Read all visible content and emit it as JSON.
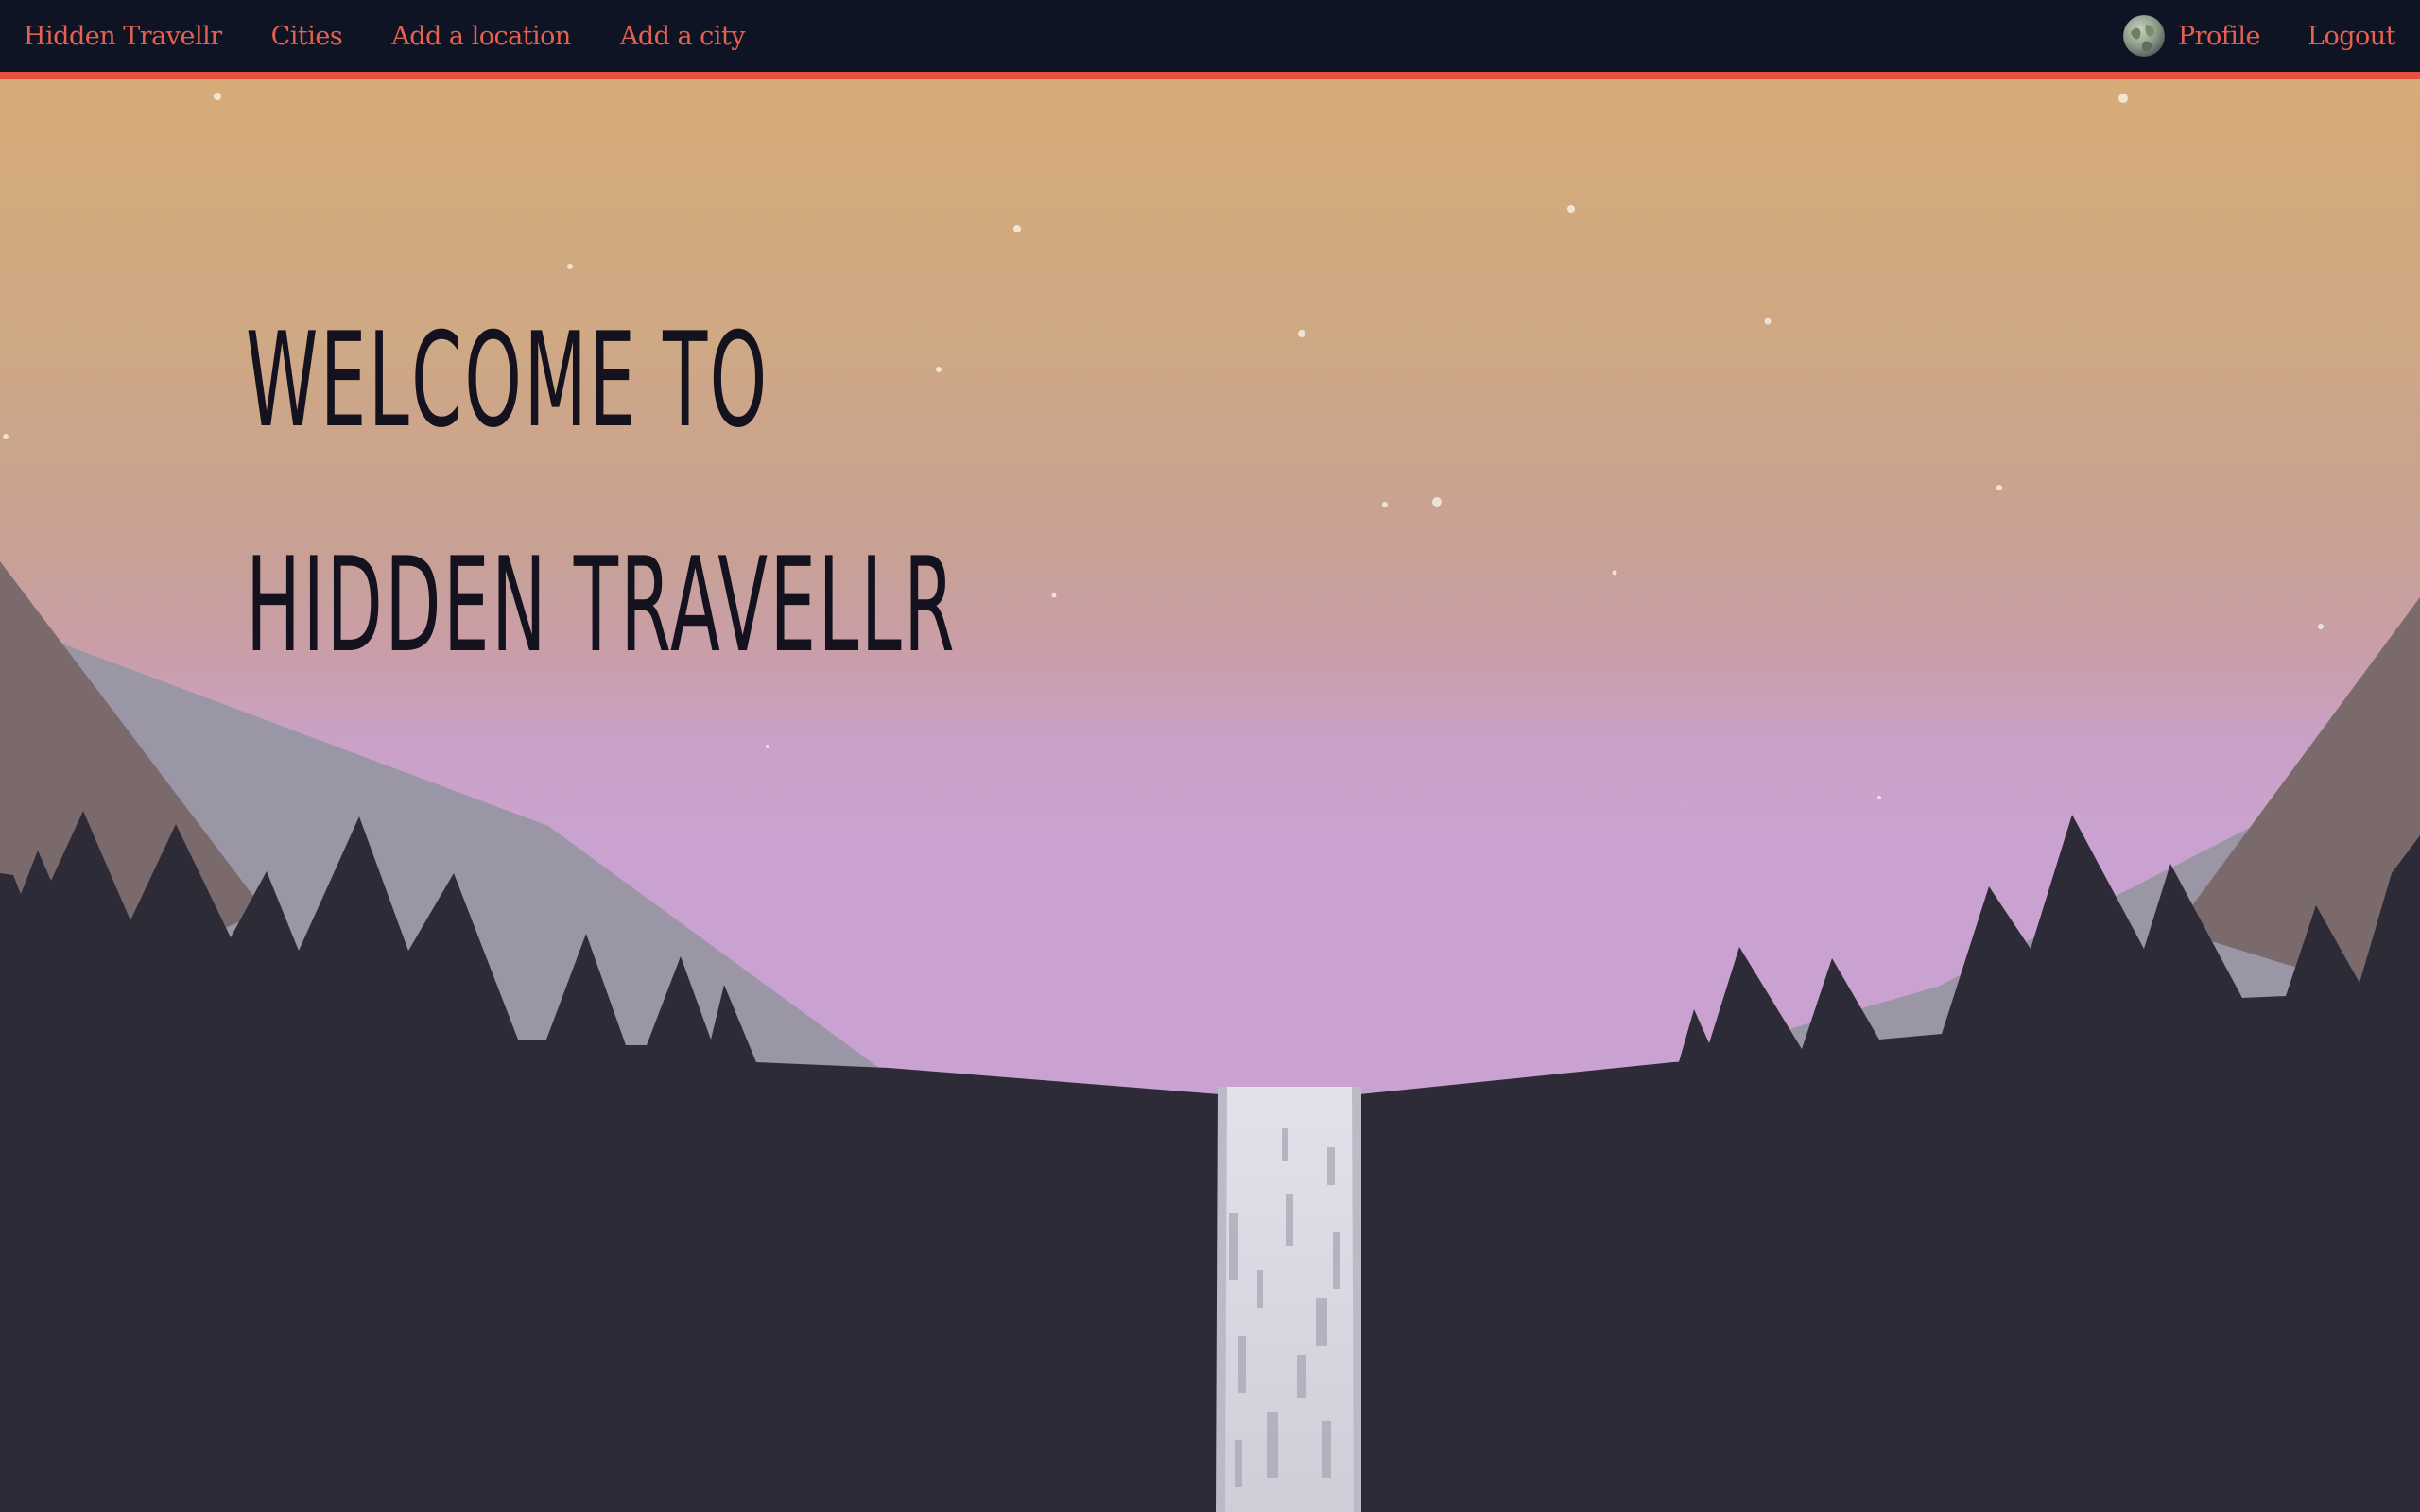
{
  "nav": {
    "brand": "Hidden Travellr",
    "links": [
      {
        "label": "Cities"
      },
      {
        "label": "Add a location"
      },
      {
        "label": "Add a city"
      }
    ],
    "profile_label": "Profile",
    "logout_label": "Logout",
    "avatar_icon": "globe-avatar-icon"
  },
  "hero": {
    "title_line1": "Welcome to",
    "title_line2": "Hidden Travellr",
    "background": "sunset mountain landscape illustration with waterfall"
  },
  "colors": {
    "navbar_bg": "#0e1424",
    "nav_link": "#e5604f",
    "accent_border": "#e8503f",
    "hero_text": "#15121f",
    "sky_top": "#d6ab78",
    "sky_bottom": "#cca0d6",
    "ground": "#2d2b38"
  }
}
